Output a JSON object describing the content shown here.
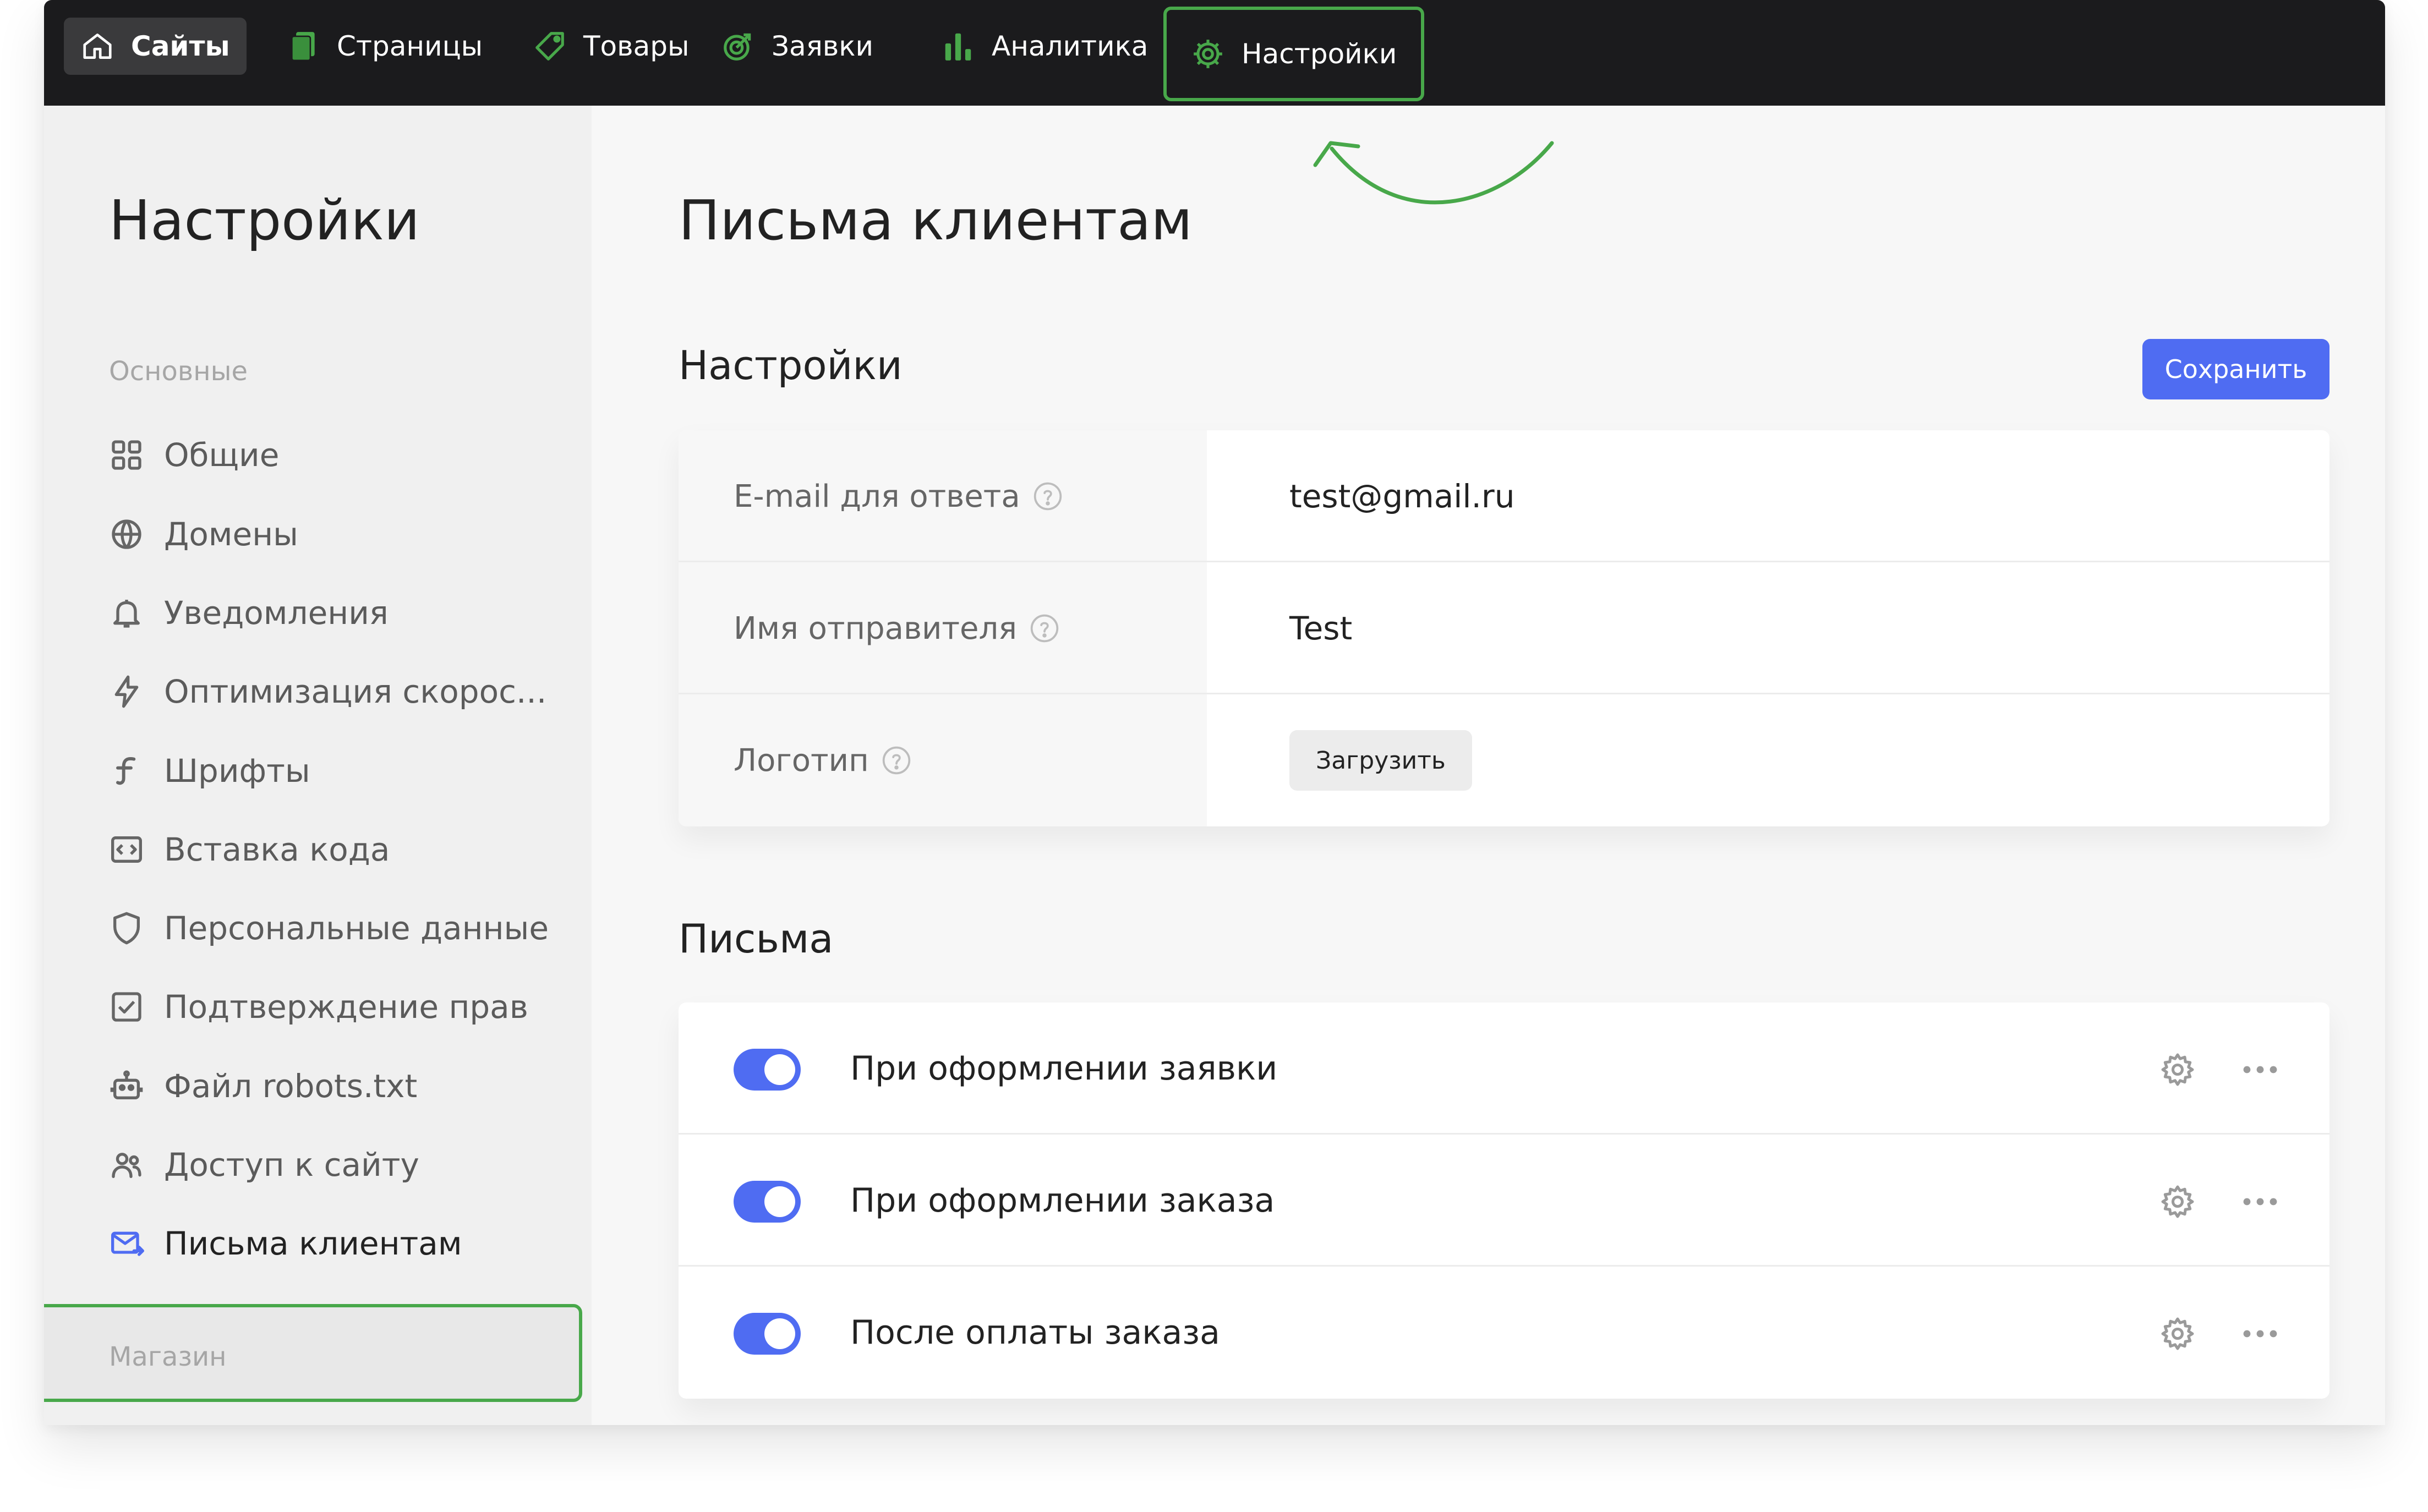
{
  "topnav": {
    "items": [
      {
        "label": "Сайты",
        "icon": "home-icon"
      },
      {
        "label": "Страницы",
        "icon": "pages-icon"
      },
      {
        "label": "Товары",
        "icon": "tag-icon"
      },
      {
        "label": "Заявки",
        "icon": "target-icon"
      },
      {
        "label": "Аналитика",
        "icon": "bar-chart-icon"
      },
      {
        "label": "Настройки",
        "icon": "gear-icon"
      }
    ],
    "highlight_color": "#48a84a"
  },
  "sidebar": {
    "title": "Настройки",
    "group_main": "Основные",
    "items": [
      {
        "label": "Общие",
        "icon": "grid-icon"
      },
      {
        "label": "Домены",
        "icon": "globe-icon"
      },
      {
        "label": "Уведомления",
        "icon": "bell-icon"
      },
      {
        "label": "Оптимизация скорос...",
        "icon": "lightning-icon"
      },
      {
        "label": "Шрифты",
        "icon": "font-icon"
      },
      {
        "label": "Вставка кода",
        "icon": "code-icon"
      },
      {
        "label": "Персональные данные",
        "icon": "shield-icon"
      },
      {
        "label": "Подтверждение прав",
        "icon": "checkbox-icon"
      },
      {
        "label": "Файл robots.txt",
        "icon": "robot-icon"
      },
      {
        "label": "Доступ к сайту",
        "icon": "users-icon"
      },
      {
        "label": "Письма клиентам",
        "icon": "mail-icon"
      }
    ],
    "group_shop": "Магазин"
  },
  "main": {
    "title": "Письма клиентам",
    "settings_title": "Настройки",
    "save_label": "Сохранить",
    "fields": [
      {
        "label": "E-mail для ответа",
        "value": "test@gmail.ru"
      },
      {
        "label": "Имя отправителя",
        "value": "Test"
      },
      {
        "label": "Логотип",
        "button": "Загрузить"
      }
    ],
    "letters_title": "Письма",
    "letters": [
      {
        "title": "При оформлении заявки",
        "enabled": true
      },
      {
        "title": "При оформлении заказа",
        "enabled": true
      },
      {
        "title": "После оплаты заказа",
        "enabled": true
      }
    ],
    "accent_color": "#4f6cf2"
  }
}
